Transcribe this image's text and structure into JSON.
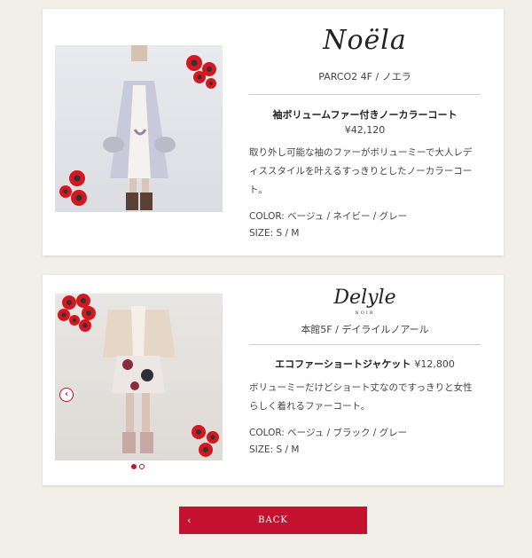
{
  "items": [
    {
      "brand": "Noëla",
      "store": "PARCO2 4F / ノエラ",
      "product_name": "袖ボリュームファー付きノーカラーコート",
      "price": "¥42,120",
      "description": "取り外し可能な袖のファーがボリューミーで大人レディススタイルを叶えるすっきりとしたノーカラーコート。",
      "color": "COLOR: ベージュ / ネイビー / グレー",
      "size": "SIZE: S / M"
    },
    {
      "brand": "Delyle",
      "brand_sub": "NOIR",
      "store": "本館5F / デイライルノアール",
      "product_name": "エコファーショートジャケット",
      "price": "¥12,800",
      "description": "ボリューミーだけどショート丈なのですっきりと女性らしく着れるファーコート。",
      "color": "COLOR: ベージュ / ブラック / グレー",
      "size": "SIZE: S / M",
      "carousel": {
        "prev": "‹",
        "next": "›",
        "slides": 2,
        "active": 1
      }
    }
  ],
  "back_button": {
    "label": "BACK",
    "icon": "chevron-left-icon"
  },
  "colors": {
    "accent": "#c41230",
    "background": "#f1efe8"
  }
}
